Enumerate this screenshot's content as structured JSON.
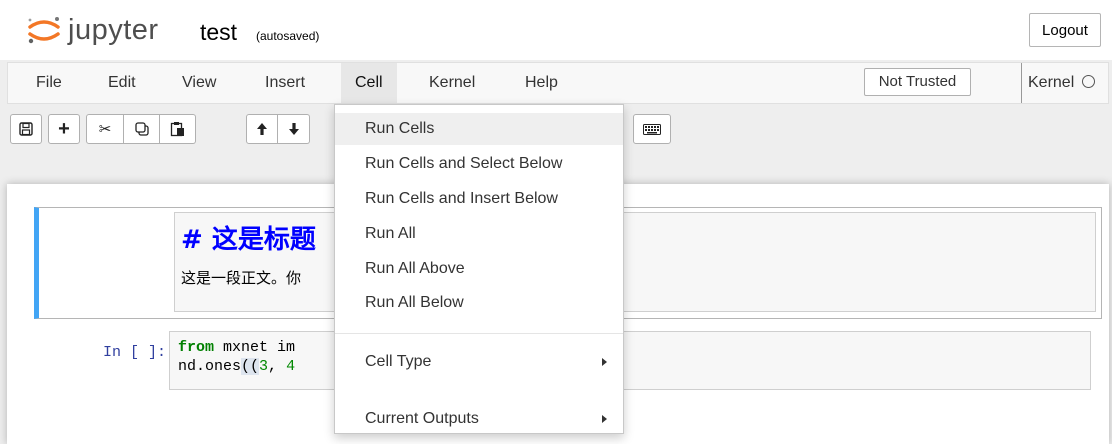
{
  "app": {
    "logo_text": "jupyter",
    "notebook_name": "test",
    "autosave_status": "(autosaved)",
    "logout_label": "Logout"
  },
  "menubar": {
    "items": [
      {
        "label": "File"
      },
      {
        "label": "Edit"
      },
      {
        "label": "View"
      },
      {
        "label": "Insert"
      },
      {
        "label": "Cell",
        "active": true
      },
      {
        "label": "Kernel"
      },
      {
        "label": "Help"
      }
    ],
    "trust_label": "Not Trusted",
    "kernel_label": "Kernel"
  },
  "toolbar": {
    "buttons": [
      {
        "icon": "save-icon",
        "glyph": "🖫"
      },
      {
        "icon": "insert-cell-below-icon",
        "glyph": "+"
      },
      {
        "icon": "cut-icon",
        "glyph": "✂"
      },
      {
        "icon": "copy-icon",
        "glyph": "⧉"
      },
      {
        "icon": "paste-icon",
        "glyph": "📋"
      },
      {
        "icon": "move-up-icon",
        "glyph": "🡑"
      },
      {
        "icon": "move-down-icon",
        "glyph": "🡓"
      },
      {
        "icon": "keyboard-icon",
        "glyph": "⌨"
      }
    ]
  },
  "cells": {
    "markdown": {
      "heading": "# 这是标题",
      "body": "这是一段正文。你"
    },
    "code": {
      "prompt": "In [ ]:",
      "line1_kw": "from",
      "line1_rest": " mxnet im",
      "line2_pre": "nd.ones",
      "line2_paren": "((",
      "line2_num": "3",
      "line2_sep": ", ",
      "line2_num2": "4"
    }
  },
  "dropdown": {
    "menu": "Cell",
    "items": [
      {
        "label": "Run Cells",
        "hover": true
      },
      {
        "label": "Run Cells and Select Below"
      },
      {
        "label": "Run Cells and Insert Below"
      },
      {
        "label": "Run All"
      },
      {
        "label": "Run All Above"
      },
      {
        "label": "Run All Below"
      },
      {
        "label": "Cell Type",
        "submenu": true
      },
      {
        "label": "Current Outputs",
        "submenu": true
      }
    ]
  },
  "colors": {
    "accent_blue": "#42a5f5",
    "heading_blue": "#0000ff",
    "prompt_blue": "#303f9f",
    "keyword_green": "#008000",
    "logo_orange": "#f37726"
  }
}
